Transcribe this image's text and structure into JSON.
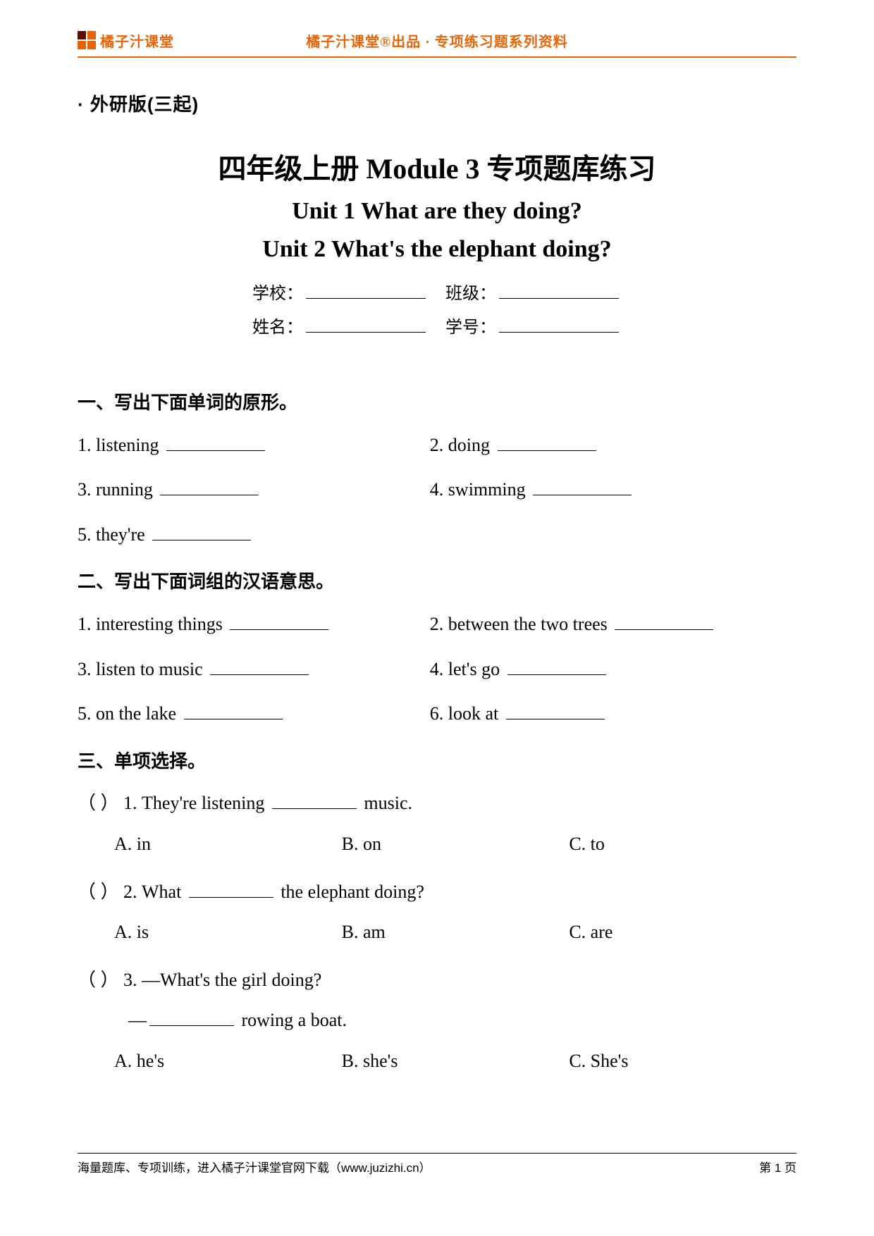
{
  "header": {
    "logo_text": "橘子汁课堂",
    "caption": "橘子汁课堂®出品 · 专项练习题系列资料"
  },
  "edition_label": "· 外研版(三起)",
  "titles": {
    "line1": "四年级上册 Module 3 专项题库练习",
    "line2": "Unit 1 What are they doing?",
    "line3": "Unit 2 What's the elephant doing?"
  },
  "student_fields": {
    "school_label": "学校：",
    "class_label": "班级：",
    "name_label": "姓名：",
    "number_label": "学号："
  },
  "sections": {
    "s1": {
      "heading": "一、写出下面单词的原形。",
      "items": [
        {
          "num": "1.",
          "text": "listening"
        },
        {
          "num": "2.",
          "text": "doing"
        },
        {
          "num": "3.",
          "text": "running"
        },
        {
          "num": "4.",
          "text": "swimming"
        },
        {
          "num": "5.",
          "text": "they're"
        }
      ]
    },
    "s2": {
      "heading": "二、写出下面词组的汉语意思。",
      "items": [
        {
          "num": "1.",
          "text": "interesting things"
        },
        {
          "num": "2.",
          "text": "between the two trees"
        },
        {
          "num": "3.",
          "text": "listen to music"
        },
        {
          "num": "4.",
          "text": "let's go"
        },
        {
          "num": "5.",
          "text": "on the lake"
        },
        {
          "num": "6.",
          "text": "look at"
        }
      ]
    },
    "s3": {
      "heading": "三、单项选择。",
      "questions": [
        {
          "paren": "（        ）",
          "num": "1.",
          "stem_before": "They're listening ",
          "stem_after": " music.",
          "opts": {
            "A": "A. in",
            "B": "B. on",
            "C": "C. to"
          }
        },
        {
          "paren": "（        ）",
          "num": "2.",
          "stem_before": "What ",
          "stem_after": " the elephant doing?",
          "opts": {
            "A": "A. is",
            "B": "B. am",
            "C": "C. are"
          }
        },
        {
          "paren": "（        ）",
          "num": "3.",
          "stem_line1": "—What's the girl doing?",
          "stem2_before": "—",
          "stem2_after": " rowing a boat.",
          "opts": {
            "A": "A. he's",
            "B": "B. she's",
            "C": "C. She's"
          }
        }
      ]
    }
  },
  "footer": {
    "left": "海量题库、专项训练，进入橘子汁课堂官网下载（www.juzizhi.cn）",
    "right": "第 1 页"
  }
}
